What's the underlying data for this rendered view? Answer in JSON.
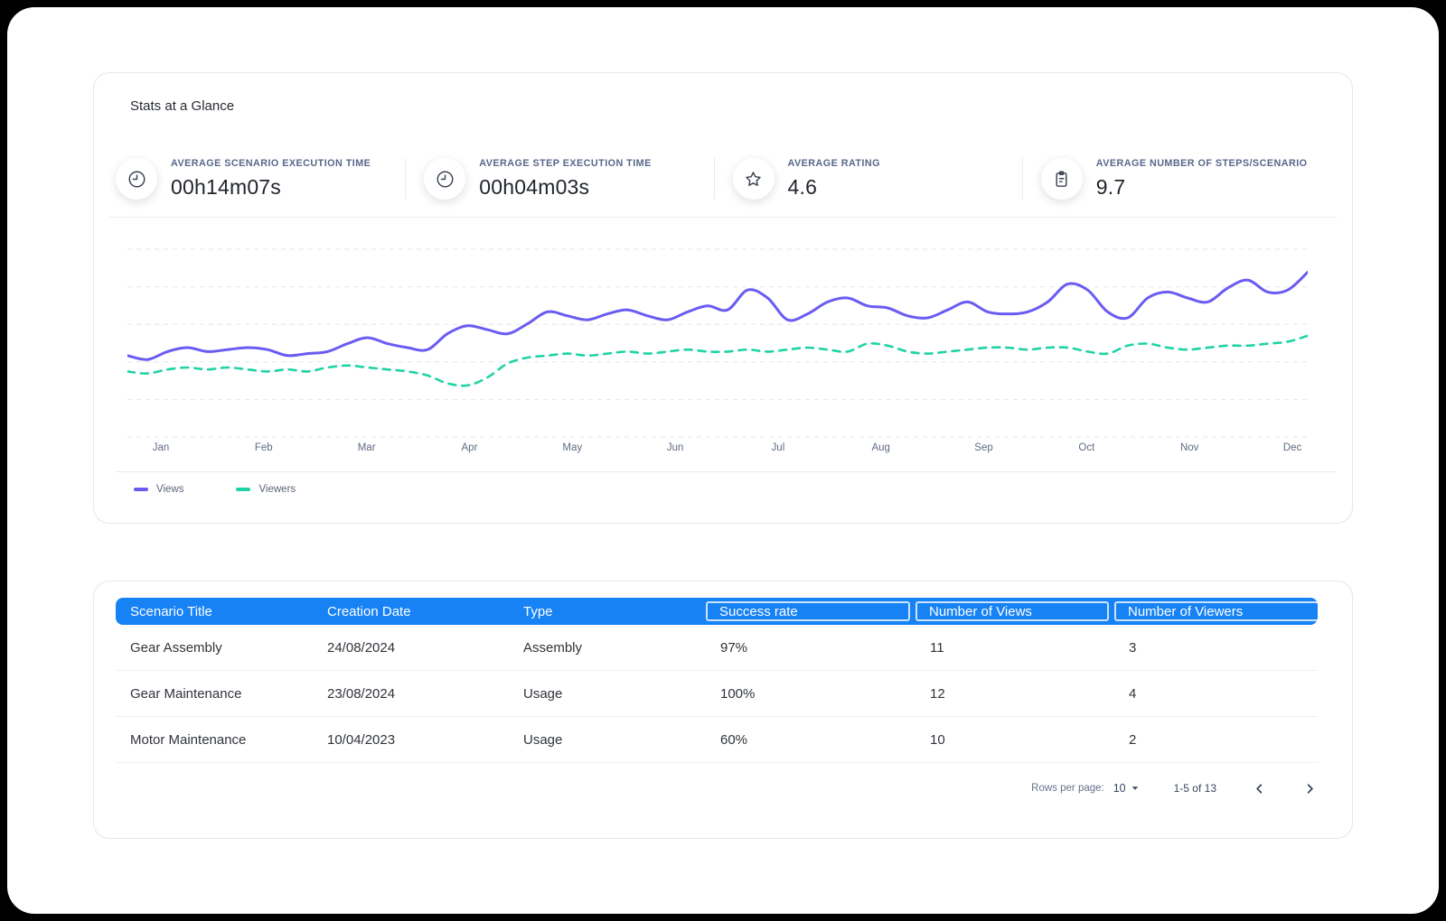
{
  "colors": {
    "page_bg": "#000000",
    "window_bg": "#ffffff",
    "accent_blue": "#1782f4",
    "views_line": "#6a5cf2",
    "viewers_line": "#1ed3a5"
  },
  "stats_card": {
    "title": "Stats at a Glance",
    "stats": [
      {
        "icon": "clock-icon",
        "label": "AVERAGE SCENARIO EXECUTION TIME",
        "value": "00h14m07s"
      },
      {
        "icon": "clock-icon",
        "label": "AVERAGE STEP EXECUTION TIME",
        "value": "00h04m03s"
      },
      {
        "icon": "star-icon",
        "label": "AVERAGE RATING",
        "value": "4.6"
      },
      {
        "icon": "clipboard-icon",
        "label": "AVERAGE NUMBER OF STEPS/SCENARIO",
        "value": "9.7"
      }
    ]
  },
  "chart_data": {
    "type": "line",
    "title": "",
    "xlabel": "",
    "ylabel": "",
    "x_labels": [
      "Jan",
      "Feb",
      "Mar",
      "Apr",
      "May",
      "Jun",
      "Jul",
      "Aug",
      "Sep",
      "Oct",
      "Nov",
      "Dec"
    ],
    "ylim": [
      0,
      100
    ],
    "grid": "horizontal-dashed",
    "legend_position": "bottom-left",
    "points_per_month": 5,
    "series": [
      {
        "name": "Views",
        "color": "#6a5cf2",
        "line_style": "solid",
        "values": [
          41,
          39,
          43,
          45,
          43,
          44,
          45,
          44,
          41,
          42,
          43,
          47,
          50,
          47,
          45,
          44,
          52,
          56,
          54,
          52,
          57,
          63,
          61,
          59,
          62,
          64,
          61,
          59,
          63,
          66,
          64,
          74,
          70,
          59,
          62,
          68,
          70,
          66,
          65,
          61,
          60,
          64,
          68,
          63,
          62,
          63,
          68,
          77,
          74,
          63,
          60,
          70,
          73,
          70,
          68,
          75,
          79,
          73,
          74,
          83
        ]
      },
      {
        "name": "Viewers",
        "color": "#1ed3a5",
        "line_style": "dashed",
        "values": [
          33,
          32,
          34,
          35,
          34,
          35,
          34,
          33,
          34,
          33,
          35,
          36,
          35,
          34,
          33,
          31,
          27,
          26,
          30,
          37,
          40,
          41,
          42,
          41,
          42,
          43,
          42,
          43,
          44,
          43,
          43,
          44,
          43,
          44,
          45,
          44,
          43,
          47,
          46,
          43,
          42,
          43,
          44,
          45,
          45,
          44,
          45,
          45,
          43,
          42,
          46,
          47,
          45,
          44,
          45,
          46,
          46,
          47,
          48,
          51
        ]
      }
    ]
  },
  "table": {
    "columns": [
      {
        "label": "Scenario Title",
        "boxed": false
      },
      {
        "label": "Creation Date",
        "boxed": false
      },
      {
        "label": "Type",
        "boxed": false
      },
      {
        "label": "Success rate",
        "boxed": true
      },
      {
        "label": "Number of Views",
        "boxed": true
      },
      {
        "label": "Number of Viewers",
        "boxed": true
      }
    ],
    "rows": [
      [
        "Gear Assembly",
        "24/08/2024",
        "Assembly",
        "97%",
        "11",
        "3"
      ],
      [
        "Gear Maintenance",
        "23/08/2024",
        "Usage",
        "100%",
        "12",
        "4"
      ],
      [
        "Motor Maintenance",
        "10/04/2023",
        "Usage",
        "60%",
        "10",
        "2"
      ]
    ],
    "pagination": {
      "rows_per_page_label": "Rows per page:",
      "rows_per_page_value": "10",
      "range_label": "1-5 of 13"
    }
  }
}
